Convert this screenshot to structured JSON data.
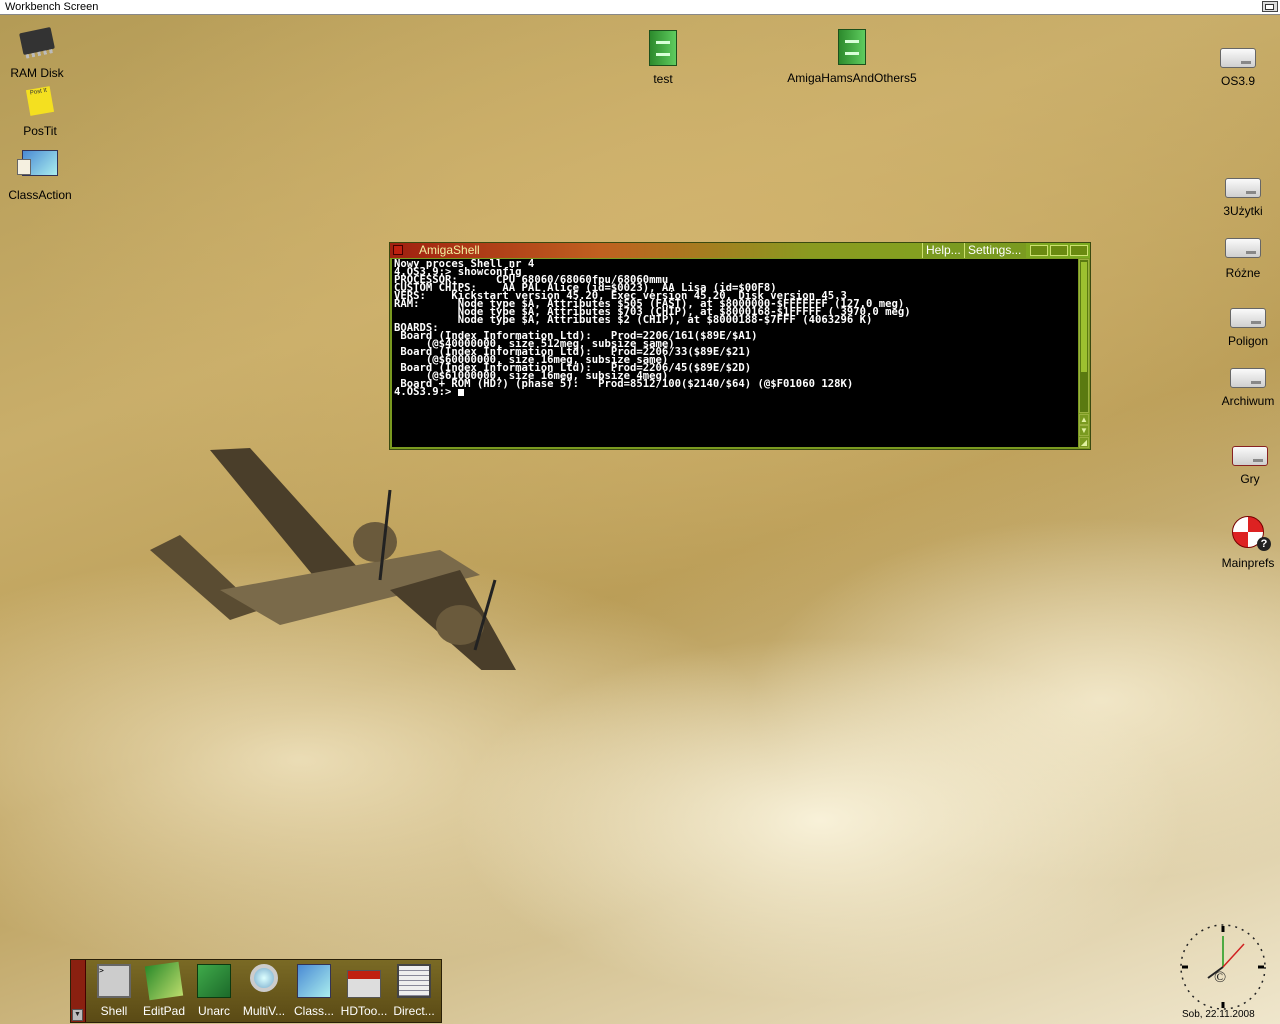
{
  "screen": {
    "title": "Workbench Screen"
  },
  "desktop_icons": {
    "ram": "RAM Disk",
    "postit": "PosTit",
    "postit_text": "Post It",
    "classaction": "ClassAction",
    "test": "test",
    "amigahams": "AmigaHamsAndOthers5",
    "os39": "OS3.9",
    "uzytki": "3Użytki",
    "rozne": "Różne",
    "poligon": "Poligon",
    "archiwum": "Archiwum",
    "gry": "Gry",
    "mainprefs": "Mainprefs"
  },
  "shell": {
    "title": "AmigaShell",
    "help": "Help...",
    "settings": "Settings...",
    "lines": [
      "Nowy proces Shell nr 4",
      "4.OS3.9:> showconfig",
      "PROCESSOR:      CPU 68060/68060fpu/68060mmu",
      "CUSTOM CHIPS:    AA PAL Alice (id=$0023), AA Lisa (id=$00F8)",
      "VERS:    Kickstart version 45.20, Exec version 45.20, Disk version 45.3",
      "RAM:      Node type $A, Attributes $505 (FAST), at $8000000-$FFFFFFF (127.0 meg)",
      "          Node type $A, Attributes $703 (CHIP), at $8000168-$1FFFFF ( 3970.0 meg)",
      "          Node type $A, Attributes $2 (CHIP), at $8000188-$7FFF (4063296 K)",
      "BOARDS:",
      " Board (Index Information Ltd):   Prod=2206/161($89E/$A1)",
      "     (@$40000000, size 512meg, subsize same)",
      " Board (Index Information Ltd):   Prod=2206/33($89E/$21)",
      "     (@$60000000, size 16meg, subsize same)",
      " Board (Index Information Ltd):   Prod=2206/45($89E/$2D)",
      "     (@$61000000, size 16meg, subsize 4meg)",
      " Board + ROM (HD?) (phase 5):   Prod=8512/100($2140/$64) (@$F01060 128K)"
    ],
    "prompt": "4.OS3.9:> "
  },
  "dock": {
    "items": [
      {
        "label": "Shell"
      },
      {
        "label": "EditPad"
      },
      {
        "label": "Unarc"
      },
      {
        "label": "MultiV..."
      },
      {
        "label": "Class..."
      },
      {
        "label": "HDToo..."
      },
      {
        "label": "Direct..."
      }
    ]
  },
  "clock": {
    "date": "Sob, 22.11.2008"
  },
  "colors": {
    "shell_frame": "#7a9a20",
    "terminal_bg": "#000000",
    "terminal_fg": "#ffffff",
    "dock_handle": "#8a2010"
  }
}
